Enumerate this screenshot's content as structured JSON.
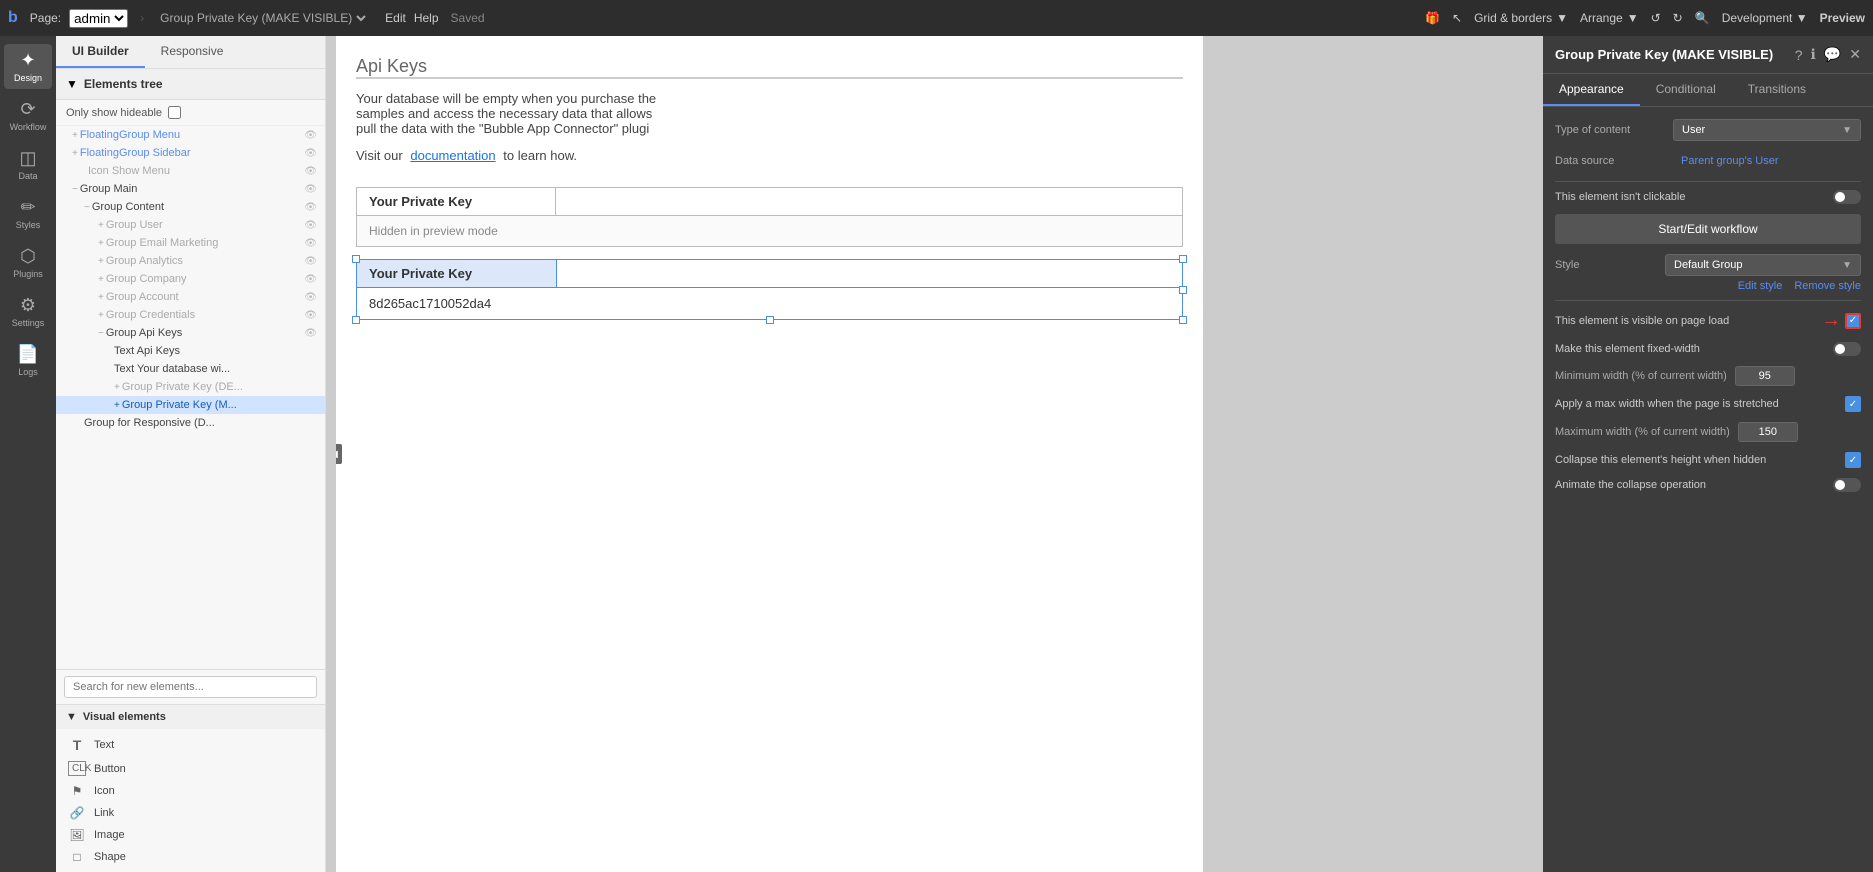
{
  "topbar": {
    "logo": "b",
    "page_label": "Page:",
    "page_value": "admin",
    "workflow_label": "Group Private Key (MAKE VISIBLE)",
    "menu": [
      "Edit",
      "Help"
    ],
    "saved": "Saved",
    "grid_borders": "Grid & borders",
    "arrange": "Arrange",
    "development": "Development",
    "preview": "Preview"
  },
  "left_sidebar": {
    "items": [
      {
        "id": "design",
        "icon": "✦",
        "label": "Design",
        "active": true
      },
      {
        "id": "workflow",
        "icon": "⟳",
        "label": "Workflow"
      },
      {
        "id": "data",
        "icon": "◫",
        "label": "Data"
      },
      {
        "id": "styles",
        "icon": "✏",
        "label": "Styles"
      },
      {
        "id": "plugins",
        "icon": "⬡",
        "label": "Plugins"
      },
      {
        "id": "settings",
        "icon": "⚙",
        "label": "Settings"
      },
      {
        "id": "logs",
        "icon": "📄",
        "label": "Logs"
      }
    ]
  },
  "panel": {
    "tabs": [
      "UI Builder",
      "Responsive"
    ],
    "active_tab": "UI Builder",
    "tree_label": "Elements tree",
    "only_hideable_label": "Only show hideable",
    "items": [
      {
        "id": "floating-menu",
        "level": 1,
        "plus": true,
        "text": "FloatingGroup Menu",
        "eye": true
      },
      {
        "id": "floating-sidebar",
        "level": 1,
        "plus": true,
        "text": "FloatingGroup Sidebar",
        "eye": true
      },
      {
        "id": "icon-show-menu",
        "level": 2,
        "text": "Icon Show Menu",
        "eye": true
      },
      {
        "id": "group-main",
        "level": 1,
        "minus": true,
        "text": "Group Main",
        "eye": true
      },
      {
        "id": "group-content",
        "level": 2,
        "minus": true,
        "text": "Group Content",
        "eye": true
      },
      {
        "id": "group-user",
        "level": 3,
        "plus": true,
        "text": "Group User",
        "eye": true
      },
      {
        "id": "group-email",
        "level": 3,
        "plus": true,
        "text": "Group Email Marketing",
        "eye": true
      },
      {
        "id": "group-analytics",
        "level": 3,
        "plus": true,
        "text": "Group Analytics",
        "eye": true
      },
      {
        "id": "group-company",
        "level": 3,
        "plus": true,
        "text": "Group Company",
        "eye": true
      },
      {
        "id": "group-account",
        "level": 3,
        "plus": true,
        "text": "Group Account",
        "eye": true
      },
      {
        "id": "group-credentials",
        "level": 3,
        "plus": true,
        "text": "Group Credentials",
        "eye": true
      },
      {
        "id": "group-api-keys",
        "level": 3,
        "minus": true,
        "text": "Group Api Keys",
        "eye": true
      },
      {
        "id": "text-api-keys",
        "level": 4,
        "text": "Text Api Keys",
        "eye": false
      },
      {
        "id": "text-database",
        "level": 4,
        "text": "Text Your database wi...",
        "eye": false
      },
      {
        "id": "group-private-key-de",
        "level": 4,
        "plus": true,
        "text": "Group Private Key (DE...",
        "eye": false
      },
      {
        "id": "group-private-key-m",
        "level": 4,
        "plus": true,
        "text": "Group Private Key (M...",
        "eye": false,
        "selected": true
      },
      {
        "id": "group-responsive",
        "level": 2,
        "text": "Group for Responsive (D...",
        "eye": false
      }
    ],
    "search_placeholder": "Search for new elements...",
    "visual_elements_label": "Visual elements",
    "visual_items": [
      {
        "id": "text",
        "icon": "T",
        "label": "Text"
      },
      {
        "id": "button",
        "icon": "▣",
        "label": "Button"
      },
      {
        "id": "icon",
        "icon": "⚑",
        "label": "Icon"
      },
      {
        "id": "link",
        "icon": "🔗",
        "label": "Link"
      },
      {
        "id": "image",
        "icon": "🖼",
        "label": "Image"
      },
      {
        "id": "shape",
        "icon": "□",
        "label": "Shape"
      }
    ]
  },
  "canvas": {
    "api_keys_title": "Api Keys",
    "description_line1": "Your database will be empty when you purchase the",
    "description_line2": "samples and access the necessary data that allows",
    "description_line3": "pull the data with the \"Bubble App Connector\" plugi",
    "visit_text": "Visit our",
    "docs_link": "documentation",
    "docs_suffix": "to learn how.",
    "private_key_label1": "Your Private Key",
    "hidden_text": "Hidden in preview mode",
    "private_key_label2": "Your Private Key",
    "private_key_value": "8d265ac1710052da4"
  },
  "right_panel": {
    "title": "Group Private Key (MAKE VISIBLE)",
    "icons": [
      "?",
      "ℹ",
      "💬",
      "✕"
    ],
    "tabs": [
      "Appearance",
      "Conditional",
      "Transitions"
    ],
    "active_tab": "Appearance",
    "type_of_content_label": "Type of content",
    "type_of_content_value": "User",
    "data_source_label": "Data source",
    "data_source_value": "Parent group's User",
    "not_clickable_label": "This element isn't clickable",
    "workflow_button": "Start/Edit workflow",
    "style_label": "Style",
    "style_value": "Default Group",
    "edit_style": "Edit style",
    "remove_style": "Remove style",
    "visible_label": "This element is visible on page load",
    "visible_checked": true,
    "fixed_width_label": "Make this element fixed-width",
    "fixed_width_checked": false,
    "min_width_label": "Minimum width (% of current width)",
    "min_width_value": "95",
    "max_width_stretch_label": "Apply a max width when the page is stretched",
    "max_width_stretch_checked": true,
    "max_width_label": "Maximum width (% of current width)",
    "max_width_value": "150",
    "collapse_label": "Collapse this element's height when hidden",
    "collapse_checked": true,
    "animate_label": "Animate the collapse operation",
    "animate_checked": false
  }
}
